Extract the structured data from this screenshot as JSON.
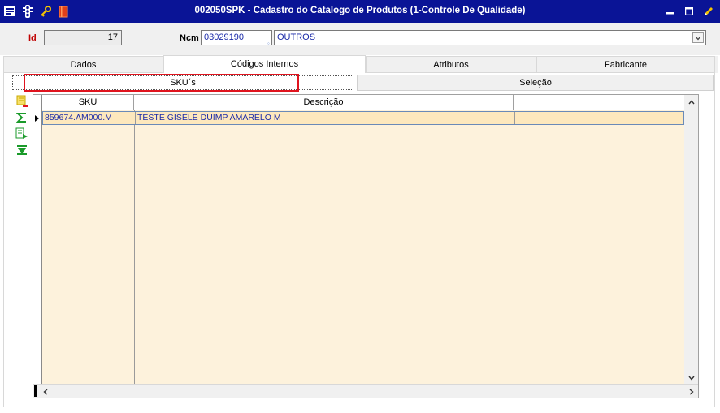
{
  "window": {
    "title": "002050SPK - Cadastro do Catalogo de Produtos (1-Controle De Qualidade)",
    "icons": [
      "grid-menu-icon",
      "traffic-light-icon",
      "key-icon",
      "book-icon"
    ],
    "controls": [
      "minimize-icon",
      "maximize-icon",
      "edit-pencil-icon"
    ]
  },
  "header": {
    "id_label": "Id",
    "id_value": "17",
    "ncm_label": "Ncm",
    "ncm_value": "03029190",
    "ncm_desc": "OUTROS"
  },
  "main_tabs": [
    {
      "label": "Dados"
    },
    {
      "label": "Códigos Internos"
    },
    {
      "label": "Atributos"
    },
    {
      "label": "Fabricante"
    }
  ],
  "sub_tabs": [
    {
      "label": "SKU´s"
    },
    {
      "label": "Seleção"
    }
  ],
  "side_tools": [
    "new-record-icon",
    "sum-icon",
    "export-icon",
    "filter-down-icon"
  ],
  "grid": {
    "columns": [
      "SKU",
      "Descrição",
      ""
    ],
    "rows": [
      {
        "sku": "859674.AM000.M",
        "descricao": "TESTE GISELE DUIMP AMARELO M"
      }
    ]
  },
  "colors": {
    "title_bar": "#0a1496",
    "grid_bg": "#fdf2dc",
    "highlight": "#e0141e",
    "text_value": "#1a2aa8"
  }
}
